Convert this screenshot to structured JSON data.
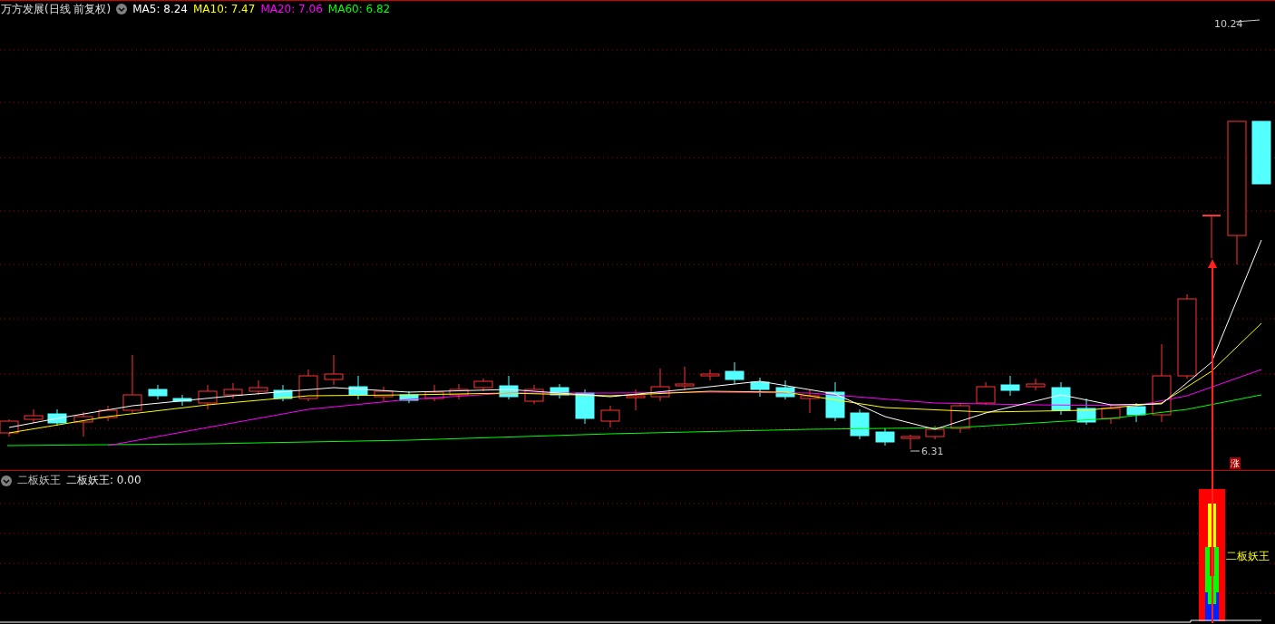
{
  "chart_header": {
    "title": "万方发展(日线 前复权)",
    "indicators": [
      {
        "label": "MA5: 8.24",
        "color": "#ffffff"
      },
      {
        "label": "MA10: 7.47",
        "color": "#ffff00"
      },
      {
        "label": "MA20: 7.06",
        "color": "#ff00ff"
      },
      {
        "label": "MA60: 6.82",
        "color": "#00ff00"
      }
    ]
  },
  "price_labels": {
    "high": "10.24",
    "low": "6.31"
  },
  "limit_up_tag": "涨",
  "indicator_header": {
    "name": "二板妖王",
    "value": "二板妖王: 0.00"
  },
  "signal_label": "二板妖王"
}
